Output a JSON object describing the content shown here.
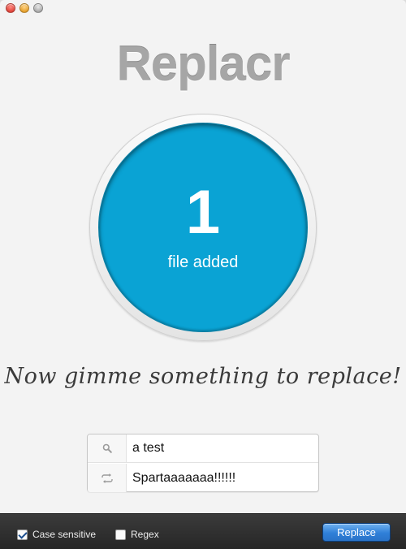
{
  "app": {
    "title": "Replacr"
  },
  "counter": {
    "count": "1",
    "label": "file added"
  },
  "prompt": "Now gimme something to replace!",
  "fields": {
    "search": {
      "value": "a test",
      "icon": "search-icon"
    },
    "replace": {
      "value": "Spartaaaaaaa!!!!!!",
      "icon": "repeat-icon"
    }
  },
  "options": {
    "case_sensitive": {
      "label": "Case sensitive",
      "checked": true
    },
    "regex": {
      "label": "Regex",
      "checked": false
    }
  },
  "toolbar": {
    "replace_label": "Replace"
  },
  "colors": {
    "accent": "#0aa3d4",
    "button": "#2f7fd8"
  }
}
